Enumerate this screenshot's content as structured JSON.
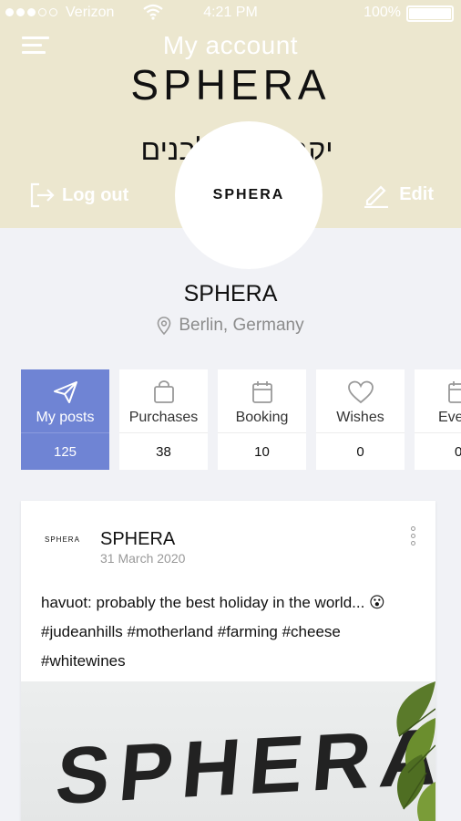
{
  "status_bar": {
    "carrier": "Verizon",
    "time": "4:21 PM",
    "battery": "100%"
  },
  "header": {
    "title": "My account",
    "brand": "SPHERA",
    "hebrew_text": "יקב מו ות לבנים",
    "logout_label": "Log out",
    "edit_label": "Edit",
    "avatar_text": "SPHERA"
  },
  "profile": {
    "name": "SPHERA",
    "location": "Berlin, Germany"
  },
  "stats": [
    {
      "label": "My posts",
      "count": "125",
      "icon": "send-icon",
      "active": true
    },
    {
      "label": "Purchases",
      "count": "38",
      "icon": "bag-icon",
      "active": false
    },
    {
      "label": "Booking",
      "count": "10",
      "icon": "calendar-icon",
      "active": false
    },
    {
      "label": "Wishes",
      "count": "0",
      "icon": "heart-icon",
      "active": false
    },
    {
      "label": "Eve",
      "count": "0",
      "icon": "calendar-icon",
      "active": false
    }
  ],
  "post": {
    "avatar_text": "SPHERA",
    "author": "SPHERA",
    "date": "31 March 2020",
    "text_line1": "havuot: probably the best holiday in the world... 😮",
    "text_line2": "#judeanhills #motherland #farming #cheese",
    "text_line3": "#whitewines",
    "image_text": "SPHERA"
  },
  "colors": {
    "header_bg": "#ece7cf",
    "accent": "#6f84d4",
    "page_bg": "#f1f2f6"
  }
}
